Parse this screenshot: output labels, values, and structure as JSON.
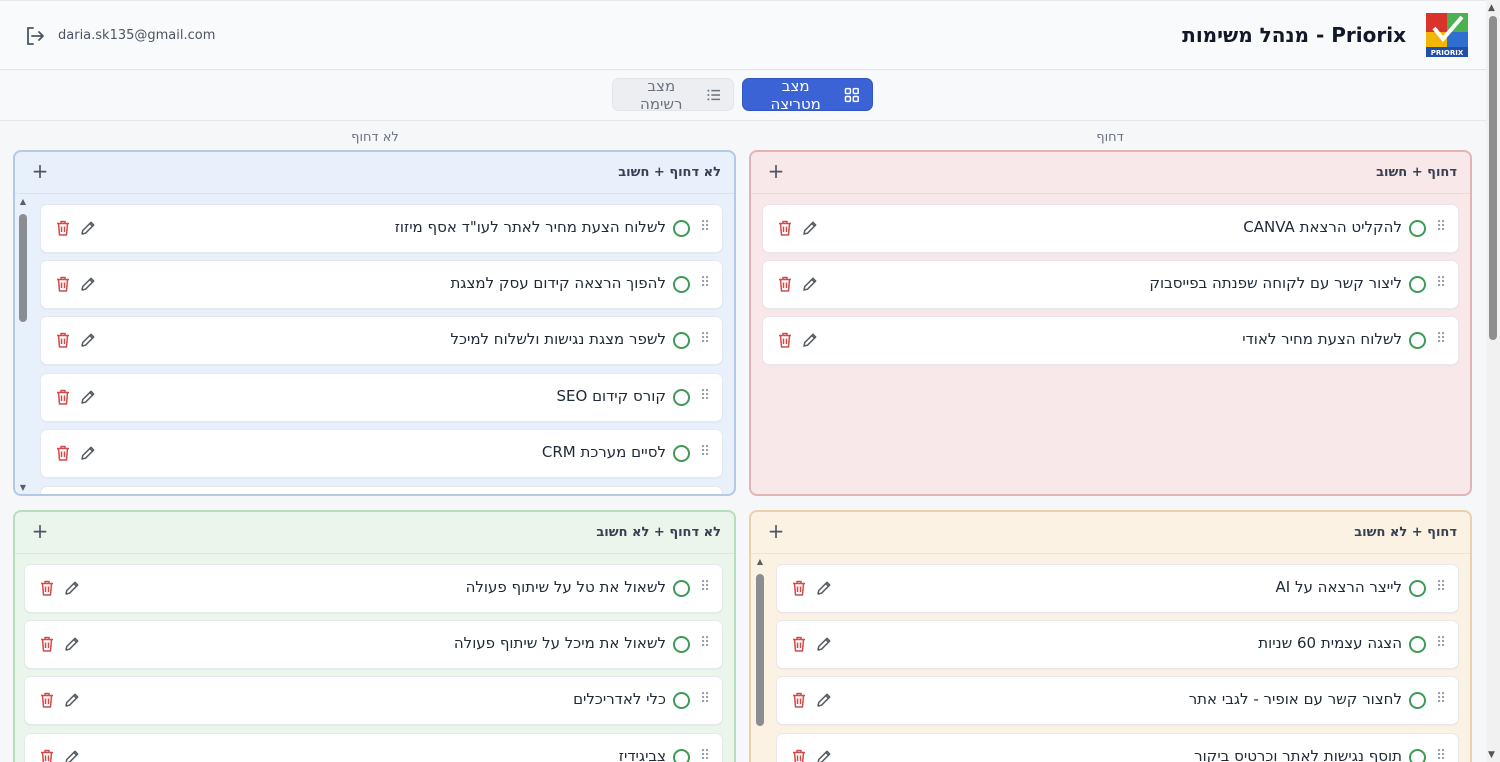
{
  "header": {
    "title": "Priorix - מנהל משימות",
    "user_email": "daria.sk135@gmail.com",
    "logo_text": "PRIORIX"
  },
  "view_toggle": {
    "matrix_label": "מצב מטריצה",
    "list_label": "מצב רשימה",
    "active": "matrix"
  },
  "axes": {
    "urgent": "דחוף",
    "not_urgent": "לא דחוף"
  },
  "quadrants": {
    "urgent_important": {
      "title": "דחוף + חשוב",
      "color": "#f8e8e9",
      "tasks": [
        "להקליט הרצאת CANVA",
        "ליצור קשר עם לקוחה שפנתה בפייסבוק",
        "לשלוח הצעת מחיר לאודי"
      ]
    },
    "not_urgent_important": {
      "title": "לא דחוף + חשוב",
      "color": "#e8f0fb",
      "tasks": [
        "לשלוח הצעת מחיר לאתר לעו\"ד אסף מיזוז",
        "להפוך הרצאה קידום עסק למצגת",
        "לשפר מצגת נגישות ולשלוח למיכל",
        "קורס קידום SEO",
        "לסיים מערכת CRM"
      ]
    },
    "urgent_not_important": {
      "title": "דחוף + לא חשוב",
      "color": "#fbf2e4",
      "tasks": [
        "לייצר הרצאה על AI",
        "הצגה עצמית 60 שניות",
        "לחצור קשר עם אופיר - לגבי אתר",
        "תוסף נגישות לאתר וכרטיס ביקור"
      ]
    },
    "not_urgent_not_important": {
      "title": "לא דחוף + לא חשוב",
      "color": "#eaf5ec",
      "tasks": [
        "לשאול את טל על שיתוף פעולה",
        "לשאול את מיכל על שיתוף פעולה",
        "כלי לאדריכלים",
        "צביגידיז"
      ]
    }
  },
  "colors": {
    "accent": "#3b63d6",
    "check": "#3e9a56",
    "delete": "#d24b4b"
  }
}
